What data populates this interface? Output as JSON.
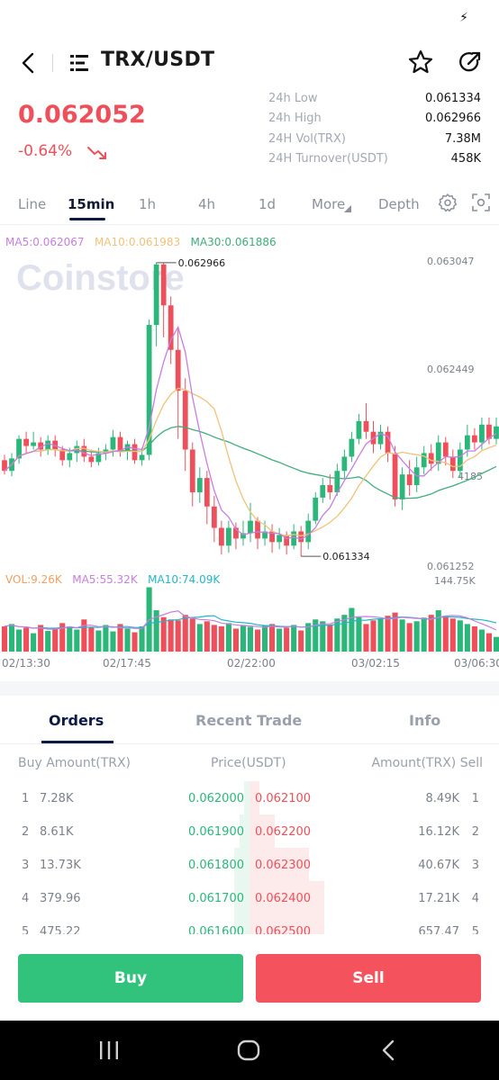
{
  "status_bar": {
    "icon": "bolt-icon"
  },
  "header": {
    "title": "TRX/USDT",
    "icons": [
      "back-icon",
      "menu-icon",
      "star-icon",
      "share-icon"
    ]
  },
  "ticker": {
    "last_price": "0.062052",
    "change": "-0.64%",
    "trend_icon": "trend-down-icon",
    "stats": [
      {
        "label": "24h Low",
        "value": "0.061334"
      },
      {
        "label": "24h High",
        "value": "0.062966"
      },
      {
        "label": "24H Vol(TRX)",
        "value": "7.38M"
      },
      {
        "label": "24H Turnover(USDT)",
        "value": "458K"
      }
    ]
  },
  "timeframes": {
    "items": [
      "Line",
      "15min",
      "1h",
      "4h",
      "1d",
      "More",
      "Depth"
    ],
    "active": "15min"
  },
  "chart": {
    "watermark": "Coinstore",
    "ma_legend": {
      "ma5": "MA5:0.062067",
      "ma10": "MA10:0.061983",
      "ma30": "MA30:0.061886"
    },
    "vol_legend": {
      "vol": "VOL:9.26K",
      "ma5": "MA5:55.32K",
      "ma10": "MA10:74.09K"
    },
    "price_axis": [
      "0.063047",
      "0.062449",
      "0.061252"
    ],
    "partial_axis_label": "4185",
    "vol_axis": "144.75K",
    "high_marker": "0.062966",
    "low_marker": "0.061334",
    "time_labels": [
      "02/13:30",
      "02/17:45",
      "02/22:00",
      "03/02:15",
      "03/06:30"
    ],
    "colors": {
      "up": "#2bb67a",
      "down": "#ef4f5a",
      "ma5": "#c77ee0",
      "ma10": "#f0c27a",
      "ma30": "#3fae7a"
    }
  },
  "chart_data": {
    "type": "candlestick",
    "title": "",
    "ylim": [
      0.06125,
      0.06305
    ],
    "candles": [
      [
        0.06186,
        0.0618,
        0.06189,
        0.06178
      ],
      [
        0.0618,
        0.06187,
        0.0619,
        0.06177
      ],
      [
        0.06187,
        0.06198,
        0.062,
        0.06184
      ],
      [
        0.06198,
        0.06194,
        0.06202,
        0.0619
      ],
      [
        0.06194,
        0.06196,
        0.06202,
        0.06192
      ],
      [
        0.06196,
        0.06192,
        0.06199,
        0.06188
      ],
      [
        0.06192,
        0.06197,
        0.062,
        0.06189
      ],
      [
        0.06197,
        0.06192,
        0.062,
        0.06188
      ],
      [
        0.06192,
        0.06186,
        0.06194,
        0.06183
      ],
      [
        0.06186,
        0.0619,
        0.06193,
        0.06182
      ],
      [
        0.0619,
        0.06194,
        0.06197,
        0.06185
      ],
      [
        0.06194,
        0.06188,
        0.06198,
        0.06185
      ],
      [
        0.06188,
        0.06185,
        0.06192,
        0.06182
      ],
      [
        0.06185,
        0.0619,
        0.06193,
        0.06183
      ],
      [
        0.0619,
        0.06192,
        0.06195,
        0.06186
      ],
      [
        0.06192,
        0.06199,
        0.06203,
        0.06188
      ],
      [
        0.06199,
        0.06191,
        0.06202,
        0.06188
      ],
      [
        0.06191,
        0.06195,
        0.06197,
        0.06186
      ],
      [
        0.06195,
        0.06186,
        0.06198,
        0.06184
      ],
      [
        0.06186,
        0.06189,
        0.06193,
        0.06183
      ],
      [
        0.06189,
        0.06262,
        0.06265,
        0.06186
      ],
      [
        0.06262,
        0.06296,
        0.06297,
        0.0625
      ],
      [
        0.06296,
        0.06273,
        0.06297,
        0.06255
      ],
      [
        0.06273,
        0.06248,
        0.06278,
        0.0624
      ],
      [
        0.06248,
        0.06225,
        0.0626,
        0.06198
      ],
      [
        0.06225,
        0.06192,
        0.06232,
        0.0618
      ],
      [
        0.06192,
        0.06168,
        0.06196,
        0.0616
      ],
      [
        0.06168,
        0.06176,
        0.06182,
        0.06162
      ],
      [
        0.06176,
        0.0616,
        0.0618,
        0.0615
      ],
      [
        0.0616,
        0.06148,
        0.06166,
        0.0614
      ],
      [
        0.06148,
        0.06138,
        0.06152,
        0.06133
      ],
      [
        0.06138,
        0.06148,
        0.06152,
        0.06134
      ],
      [
        0.06148,
        0.06142,
        0.06151,
        0.06136
      ],
      [
        0.06142,
        0.06145,
        0.06152,
        0.06138
      ],
      [
        0.06145,
        0.06152,
        0.06162,
        0.0614
      ],
      [
        0.06152,
        0.06142,
        0.06154,
        0.06136
      ],
      [
        0.06142,
        0.06146,
        0.06152,
        0.06138
      ],
      [
        0.06146,
        0.0614,
        0.0615,
        0.06134
      ],
      [
        0.0614,
        0.06144,
        0.06148,
        0.06136
      ],
      [
        0.06144,
        0.06138,
        0.06146,
        0.06133
      ],
      [
        0.06138,
        0.06146,
        0.0615,
        0.06136
      ],
      [
        0.06146,
        0.0614,
        0.06149,
        0.06132
      ],
      [
        0.0614,
        0.06152,
        0.06156,
        0.06136
      ],
      [
        0.06152,
        0.06165,
        0.06168,
        0.0615
      ],
      [
        0.06165,
        0.06172,
        0.06176,
        0.06162
      ],
      [
        0.06172,
        0.06168,
        0.06178,
        0.06164
      ],
      [
        0.06168,
        0.0618,
        0.06184,
        0.06166
      ],
      [
        0.0618,
        0.06188,
        0.06192,
        0.06176
      ],
      [
        0.06188,
        0.06198,
        0.06202,
        0.06185
      ],
      [
        0.06198,
        0.06208,
        0.06212,
        0.06195
      ],
      [
        0.06208,
        0.06202,
        0.06218,
        0.06198
      ],
      [
        0.06202,
        0.06195,
        0.06208,
        0.0619
      ],
      [
        0.06195,
        0.06202,
        0.06206,
        0.06192
      ],
      [
        0.06202,
        0.0619,
        0.06205,
        0.06185
      ],
      [
        0.0619,
        0.06164,
        0.06194,
        0.0616
      ],
      [
        0.06164,
        0.06178,
        0.06182,
        0.06158
      ],
      [
        0.06178,
        0.06172,
        0.06186,
        0.06166
      ],
      [
        0.06172,
        0.06182,
        0.06188,
        0.06168
      ],
      [
        0.06182,
        0.0619,
        0.06194,
        0.06178
      ],
      [
        0.0619,
        0.06184,
        0.06195,
        0.0618
      ],
      [
        0.06184,
        0.06196,
        0.062,
        0.0618
      ],
      [
        0.06196,
        0.06188,
        0.06199,
        0.06183
      ],
      [
        0.06188,
        0.0618,
        0.06192,
        0.06176
      ],
      [
        0.0618,
        0.06192,
        0.06196,
        0.06176
      ],
      [
        0.06192,
        0.062,
        0.06206,
        0.06188
      ],
      [
        0.062,
        0.06196,
        0.06204,
        0.06192
      ],
      [
        0.06196,
        0.06206,
        0.0621,
        0.06192
      ],
      [
        0.06206,
        0.06198,
        0.0621,
        0.06195
      ],
      [
        0.06198,
        0.06205,
        0.0621,
        0.06195
      ]
    ],
    "volumes": [
      55,
      60,
      48,
      52,
      40,
      58,
      45,
      50,
      62,
      55,
      48,
      70,
      52,
      46,
      58,
      44,
      60,
      50,
      42,
      55,
      140,
      90,
      75,
      70,
      68,
      80,
      72,
      60,
      66,
      58,
      55,
      62,
      50,
      58,
      54,
      48,
      56,
      60,
      50,
      52,
      58,
      46,
      62,
      70,
      66,
      58,
      72,
      80,
      95,
      75,
      60,
      68,
      72,
      78,
      85,
      70,
      62,
      66,
      74,
      80,
      90,
      78,
      72,
      68,
      60,
      55,
      48,
      40,
      32
    ],
    "ma_lines": [
      "MA5",
      "MA10",
      "MA30"
    ],
    "volume_lines": [
      "MA5",
      "MA10"
    ]
  },
  "order_tabs": {
    "items": [
      "Orders",
      "Recent Trade",
      "Info"
    ],
    "active": "Orders"
  },
  "order_book": {
    "headers": {
      "left": "Buy Amount(TRX)",
      "mid": "Price(USDT)",
      "right": "Amount(TRX) Sell"
    },
    "rows": [
      {
        "idx": "1",
        "buy": "7.28K",
        "bid": "0.062000",
        "ask": "0.062100",
        "sell": "8.49K",
        "sidx": "1",
        "bid_depth": 0.01,
        "ask_depth": 0.02
      },
      {
        "idx": "2",
        "buy": "8.61K",
        "bid": "0.061900",
        "ask": "0.062200",
        "sell": "16.12K",
        "sidx": "2",
        "bid_depth": 0.02,
        "ask_depth": 0.05
      },
      {
        "idx": "3",
        "buy": "13.73K",
        "bid": "0.061800",
        "ask": "0.062300",
        "sell": "40.67K",
        "sidx": "3",
        "bid_depth": 0.03,
        "ask_depth": 0.12
      },
      {
        "idx": "4",
        "buy": "379.96",
        "bid": "0.061700",
        "ask": "0.062400",
        "sell": "17.21K",
        "sidx": "4",
        "bid_depth": 0.03,
        "ask_depth": 0.15
      },
      {
        "idx": "5",
        "buy": "475.22",
        "bid": "0.061600",
        "ask": "0.062500",
        "sell": "657.47",
        "sidx": "5",
        "bid_depth": 0.03,
        "ask_depth": 0.15
      }
    ]
  },
  "actions": {
    "buy": "Buy",
    "sell": "Sell"
  },
  "system_nav": {
    "icons": [
      "recents-icon",
      "home-icon",
      "back-nav-icon"
    ]
  }
}
